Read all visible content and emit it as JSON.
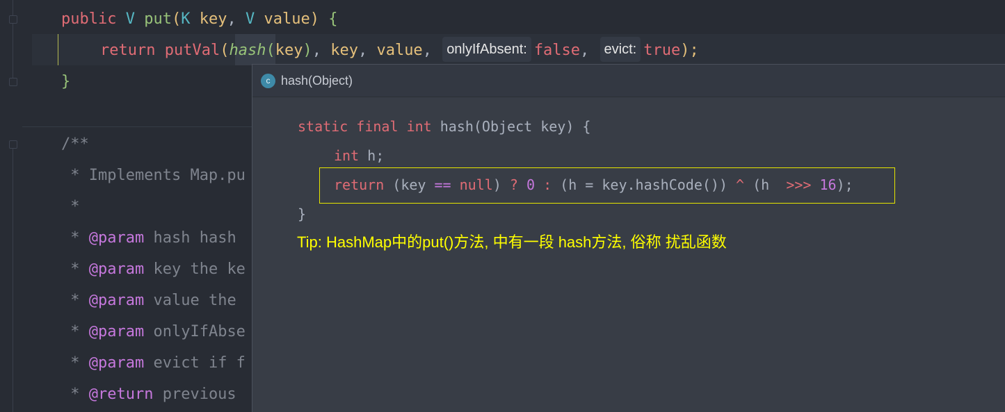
{
  "editor": {
    "lines": {
      "signature": {
        "modifier": "public",
        "return_type": "V",
        "method": "put",
        "paren_open": "(",
        "p1_type": "K",
        "p1_name": "key",
        "comma": ",",
        "p2_type": "V",
        "p2_name": "value",
        "paren_close": ")",
        "brace": "{"
      },
      "return_stmt": {
        "keyword": "return",
        "call": "putVal",
        "paren_open": "(",
        "hash_fn": "hash",
        "inner_open": "(",
        "arg_key": "key",
        "inner_close": ")",
        "sep1": ", ",
        "arg_key2": "key",
        "sep2": ", ",
        "arg_value": "value",
        "sep3": ",",
        "hint_only_if_absent": "onlyIfAbsent:",
        "val_false": "false",
        "sep4": ",",
        "hint_evict": "evict:",
        "val_true": "true",
        "close": ");"
      },
      "closing_brace": "}",
      "javadoc_open": "/**",
      "doc_lines": [
        {
          "prefix": " * ",
          "tag": "",
          "text": "Implements Map.pu"
        },
        {
          "prefix": " *",
          "tag": "",
          "text": ""
        },
        {
          "prefix": " * ",
          "tag": "@param",
          "text": " hash hash"
        },
        {
          "prefix": " * ",
          "tag": "@param",
          "text": " key the ke"
        },
        {
          "prefix": " * ",
          "tag": "@param",
          "text": " value the"
        },
        {
          "prefix": " * ",
          "tag": "@param",
          "text": " onlyIfAbse"
        },
        {
          "prefix": " * ",
          "tag": "@param",
          "text": " evict if f"
        },
        {
          "prefix": " * ",
          "tag": "@return",
          "text": " previous"
        }
      ]
    }
  },
  "popup": {
    "icon_letter": "c",
    "title": "hash(Object)",
    "code": {
      "l1_kw": "static final int",
      "l1_rest": " hash(Object key) {",
      "l2_kw": "int",
      "l2_rest": " h;",
      "l3_return": "return",
      "l3_a": " (key ",
      "l3_eq": "==",
      "l3_sp": " ",
      "l3_null": "null",
      "l3_b": ") ",
      "l3_q": "?",
      "l3_sp2": " ",
      "l3_zero": "0",
      "l3_sp3": " ",
      "l3_colon": ":",
      "l3_c": " (h = key.hashCode()) ",
      "l3_xor": "^",
      "l3_d": " (h  ",
      "l3_shift": ">>>",
      "l3_sp4": " ",
      "l3_sixteen": "16",
      "l3_end": ");",
      "l4": "}"
    },
    "tip": "Tip: HashMap中的put()方法, 中有一段 hash方法, 俗称 扰乱函数"
  },
  "colors": {
    "background": "#282c34",
    "popup_background": "#383d46",
    "highlight_box": "#e6e600",
    "tip_text": "#ffff00"
  }
}
